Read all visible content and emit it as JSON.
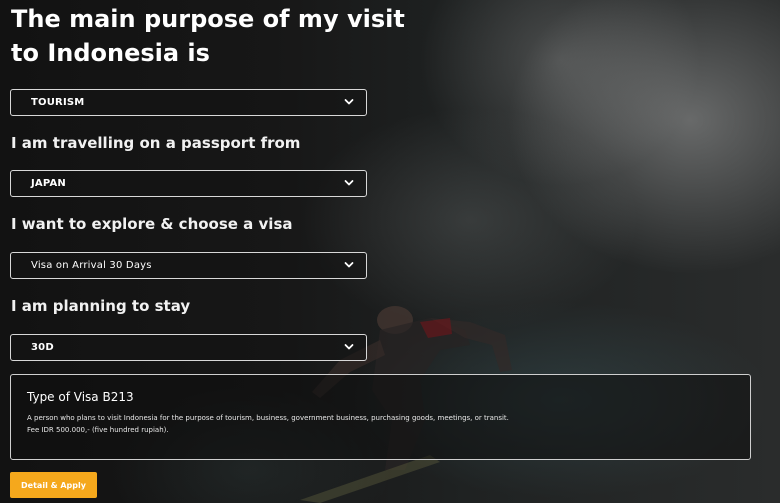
{
  "heading": {
    "title": "The main purpose of my visit to Indonesia is"
  },
  "purpose": {
    "selected": "TOURISM",
    "chevron_icon": "chevron-down-icon"
  },
  "passport": {
    "label": "I am travelling on a passport from",
    "selected": "JAPAN",
    "chevron_icon": "chevron-down-icon"
  },
  "visa": {
    "label": "I want to explore & choose a visa",
    "selected": "Visa on Arrival 30 Days",
    "chevron_icon": "chevron-down-icon"
  },
  "stay": {
    "label": "I am planning to stay",
    "selected": "30D",
    "chevron_icon": "chevron-down-icon"
  },
  "visa_info": {
    "title": "Type of Visa B213",
    "description": "A person who plans to visit Indonesia for the purpose of tourism, business, government business, purchasing goods, meetings, or transit.",
    "fee": "Fee IDR 500.000,- (five hundred rupiah)."
  },
  "actions": {
    "apply_label": "Detail & Apply"
  },
  "colors": {
    "accent": "#f5a81c",
    "text": "#ffffff",
    "border": "#d8d8d8"
  }
}
